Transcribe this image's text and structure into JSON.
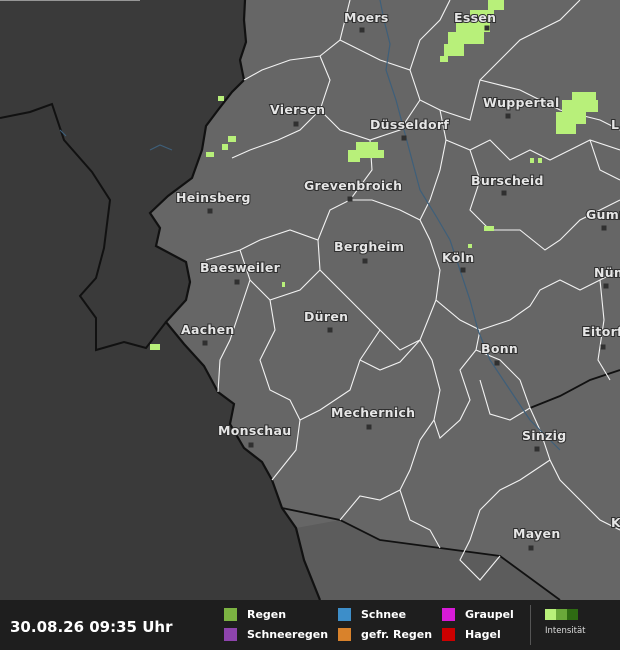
{
  "map": {
    "cities": [
      {
        "name": "Moers"
      },
      {
        "name": "Essen"
      },
      {
        "name": "Viersen"
      },
      {
        "name": "Wuppertal"
      },
      {
        "name": "Düsseldorf"
      },
      {
        "name": "Heinsberg"
      },
      {
        "name": "Grevenbroich"
      },
      {
        "name": "Burscheid"
      },
      {
        "name": "Gumm"
      },
      {
        "name": "Bergheim"
      },
      {
        "name": "Baesweiler"
      },
      {
        "name": "Köln"
      },
      {
        "name": "Nüm"
      },
      {
        "name": "Aachen"
      },
      {
        "name": "Düren"
      },
      {
        "name": "Eitorf"
      },
      {
        "name": "Bonn"
      },
      {
        "name": "Mechernich"
      },
      {
        "name": "Monschau"
      },
      {
        "name": "Sinzig"
      },
      {
        "name": "Mayen"
      },
      {
        "name": "L"
      },
      {
        "name": "K"
      }
    ],
    "colors": {
      "outside_region": "#3a3a3a",
      "region": "#666666",
      "precip_light": "#b8f07a"
    }
  },
  "legend": {
    "timestamp": "30.08.26 09:35 Uhr",
    "items": [
      {
        "label": "Regen",
        "color": "#7cb342"
      },
      {
        "label": "Schnee",
        "color": "#3d8ec9"
      },
      {
        "label": "Graupel",
        "color": "#d81bd8"
      },
      {
        "label": "Schneeregen",
        "color": "#8e44ad"
      },
      {
        "label": "gefr. Regen",
        "color": "#d9822b"
      },
      {
        "label": "Hagel",
        "color": "#cc0000"
      }
    ],
    "intensity_label": "Intensität",
    "intensity_colors": [
      "#b8f07a",
      "#6aa83a",
      "#2e6b12"
    ]
  }
}
